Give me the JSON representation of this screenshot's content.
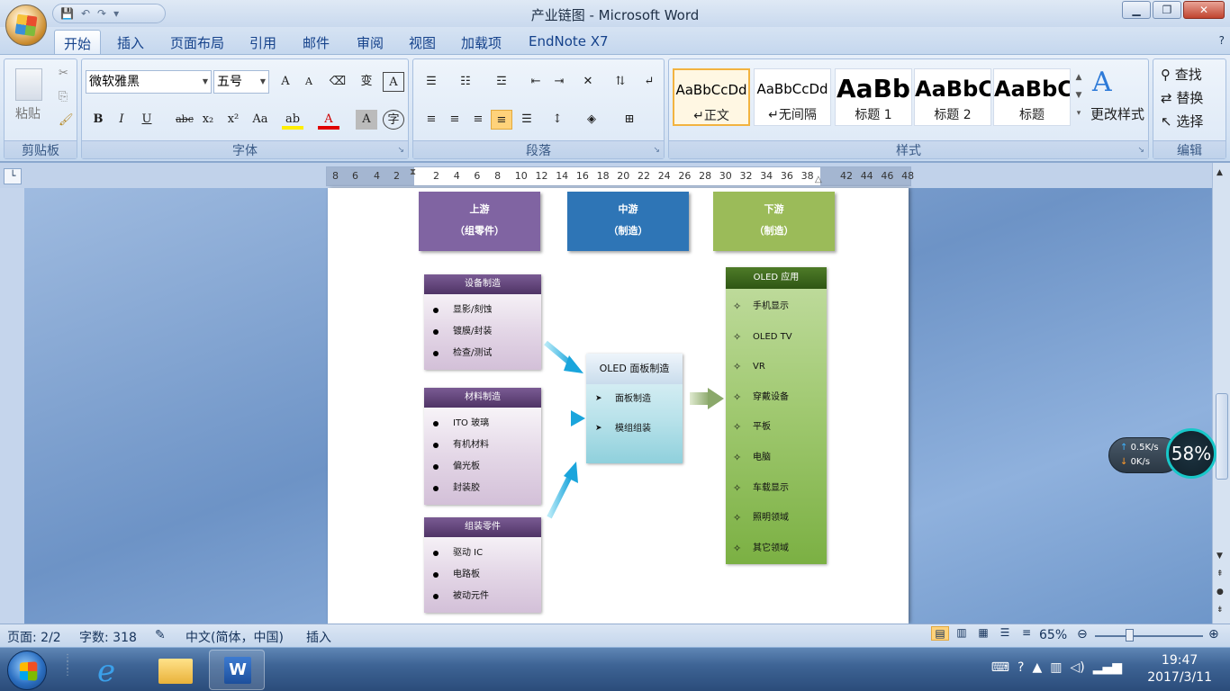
{
  "window": {
    "title": "产业链图 - Microsoft Word",
    "min_icon": "minimize-icon",
    "max_icon": "maximize-icon",
    "close_icon": "close-icon"
  },
  "qat": {
    "save_icon": "save-icon",
    "undo_icon": "undo-icon",
    "redo_icon": "redo-icon"
  },
  "tabs": [
    "开始",
    "插入",
    "页面布局",
    "引用",
    "邮件",
    "审阅",
    "视图",
    "加载项",
    "EndNote X7"
  ],
  "active_tab": "开始",
  "ribbon": {
    "clipboard": {
      "label": "剪贴板",
      "paste": "粘贴"
    },
    "font": {
      "label": "字体",
      "font_name": "微软雅黑",
      "font_size": "五号"
    },
    "paragraph": {
      "label": "段落"
    },
    "styles": {
      "label": "样式",
      "items": [
        {
          "preview": "AaBbCcDd",
          "name": "↵正文"
        },
        {
          "preview": "AaBbCcDd",
          "name": "↵无间隔"
        },
        {
          "preview": "AaBb",
          "name": "标题 1"
        },
        {
          "preview": "AaBbC",
          "name": "标题 2"
        },
        {
          "preview": "AaBbC",
          "name": "标题"
        }
      ],
      "change": "更改样式"
    },
    "editing": {
      "label": "编辑",
      "find": "查找",
      "replace": "替换",
      "select": "选择"
    }
  },
  "ruler": {
    "numbers": [
      "8",
      "6",
      "4",
      "2",
      "2",
      "4",
      "6",
      "8",
      "10",
      "12",
      "14",
      "16",
      "18",
      "20",
      "22",
      "24",
      "26",
      "28",
      "30",
      "32",
      "34",
      "36",
      "38",
      "42",
      "44",
      "46",
      "48"
    ]
  },
  "doc": {
    "top_boxes": [
      {
        "title": "上游",
        "sub": "（组零件）",
        "color": "#8064a2"
      },
      {
        "title": "中游",
        "sub": "（制造）",
        "color": "#2e75b6"
      },
      {
        "title": "下游",
        "sub": "（制造）",
        "color": "#9bbb59"
      }
    ],
    "left_boxes": [
      {
        "header": "设备制造",
        "items": [
          "显影/刻蚀",
          "镀膜/封装",
          "检查/测试"
        ]
      },
      {
        "header": "材料制造",
        "items": [
          "ITO 玻璃",
          "有机材料",
          "偏光板",
          "封装胶"
        ]
      },
      {
        "header": "组装零件",
        "items": [
          "驱动 IC",
          "电路板",
          "被动元件"
        ]
      }
    ],
    "middle": {
      "header": "OLED 面板制造",
      "items": [
        "面板制造",
        "模组组装"
      ]
    },
    "oled": {
      "header": "OLED 应用",
      "items": [
        "手机显示",
        "OLED TV",
        "VR",
        "穿戴设备",
        "平板",
        "电脑",
        "车载显示",
        "照明领域",
        "其它领域"
      ]
    }
  },
  "status": {
    "page": "页面: 2/2",
    "words": "字数: 318",
    "lang": "中文(简体，中国)",
    "mode": "插入",
    "zoom": "65%"
  },
  "net_widget": {
    "up": "0.5K/s",
    "down": "0K/s",
    "percent": "58%"
  },
  "taskbar": {
    "time": "19:47",
    "date": "2017/3/11"
  }
}
